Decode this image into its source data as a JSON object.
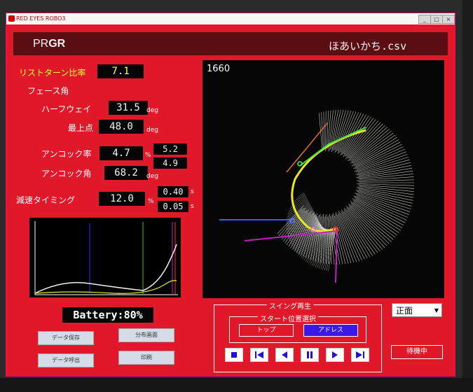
{
  "window": {
    "title": "RED EYES ROBO3",
    "controls": [
      "_",
      "□",
      "×"
    ]
  },
  "header": {
    "app_prefix": "PR",
    "app_suffix": "GR",
    "filename": "ほあいかち.csv"
  },
  "metrics": {
    "list_turn_ratio": {
      "label": "リストターン比率",
      "value": "7.1"
    },
    "phase_angle": {
      "label": "フェース角"
    },
    "half_way": {
      "label": "ハーフウェイ",
      "value": "31.5",
      "unit": "deg"
    },
    "top_point": {
      "label": "最上点",
      "value": "48.0",
      "unit": "deg"
    },
    "uncock_rate": {
      "label": "アンコック率",
      "value": "4.7",
      "unit": "%",
      "sub1": "5.2",
      "sub2": "4.9"
    },
    "uncock_angle": {
      "label": "アンコック角",
      "value": "68.2",
      "unit": "deg"
    },
    "decel_timing": {
      "label": "減速タイミング",
      "value": "12.0",
      "unit": "%",
      "sub1": "0.40",
      "sub1_unit": "s",
      "sub2": "0.05",
      "sub2_unit": "s"
    }
  },
  "battery": "Battery:80%",
  "buttons": {
    "data_save": "データ保存",
    "distribution": "分布画面",
    "data_load": "データ呼出",
    "print": "印刷"
  },
  "plot": {
    "label": "1660"
  },
  "playback": {
    "title": "スイング再生",
    "start_pos_title": "スタート位置選択",
    "top": "トップ",
    "address": "アドレス"
  },
  "view_select": {
    "value": "正面"
  },
  "standby": "待機中",
  "colors": {
    "bg": "#e0182a",
    "header": "#5a0d12",
    "address_btn": "#3a18e8"
  }
}
